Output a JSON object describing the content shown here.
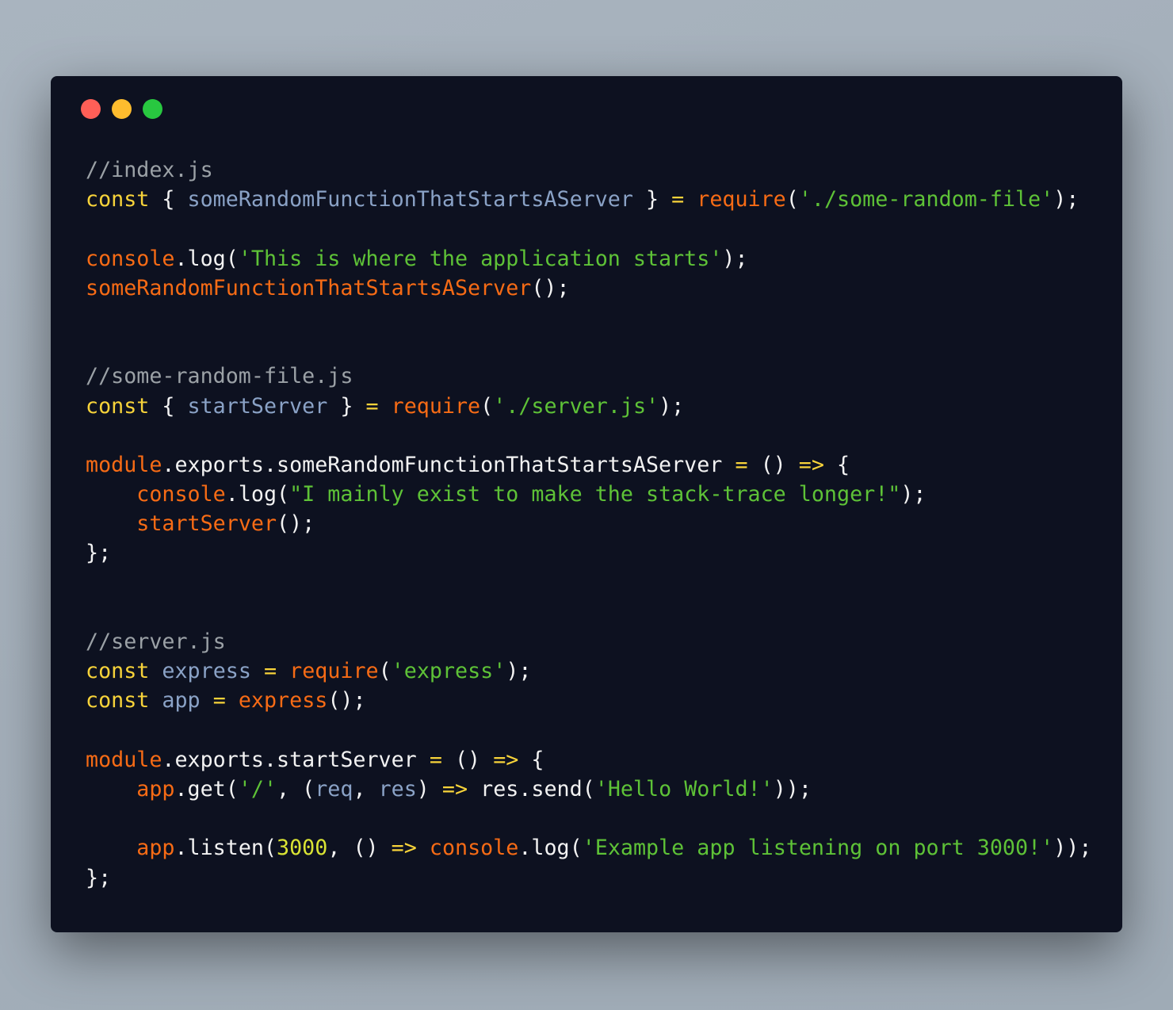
{
  "window": {
    "controls": [
      "close",
      "minimize",
      "maximize"
    ]
  },
  "code": {
    "language": "javascript",
    "lines": [
      [
        {
          "t": "comment",
          "v": "//index.js"
        }
      ],
      [
        {
          "t": "keyword",
          "v": "const"
        },
        {
          "t": "plain",
          "v": " { "
        },
        {
          "t": "var",
          "v": "someRandomFunctionThatStartsAServer"
        },
        {
          "t": "plain",
          "v": " } "
        },
        {
          "t": "op",
          "v": "="
        },
        {
          "t": "plain",
          "v": " "
        },
        {
          "t": "fn",
          "v": "require"
        },
        {
          "t": "plain",
          "v": "("
        },
        {
          "t": "str",
          "v": "'./some-random-file'"
        },
        {
          "t": "plain",
          "v": ");"
        }
      ],
      [],
      [
        {
          "t": "fn",
          "v": "console"
        },
        {
          "t": "plain",
          "v": ".log("
        },
        {
          "t": "str",
          "v": "'This is where the application starts'"
        },
        {
          "t": "plain",
          "v": ");"
        }
      ],
      [
        {
          "t": "fn",
          "v": "someRandomFunctionThatStartsAServer"
        },
        {
          "t": "plain",
          "v": "();"
        }
      ],
      [],
      [],
      [
        {
          "t": "comment",
          "v": "//some-random-file.js"
        }
      ],
      [
        {
          "t": "keyword",
          "v": "const"
        },
        {
          "t": "plain",
          "v": " { "
        },
        {
          "t": "var",
          "v": "startServer"
        },
        {
          "t": "plain",
          "v": " } "
        },
        {
          "t": "op",
          "v": "="
        },
        {
          "t": "plain",
          "v": " "
        },
        {
          "t": "fn",
          "v": "require"
        },
        {
          "t": "plain",
          "v": "("
        },
        {
          "t": "str",
          "v": "'./server.js'"
        },
        {
          "t": "plain",
          "v": ");"
        }
      ],
      [],
      [
        {
          "t": "fn",
          "v": "module"
        },
        {
          "t": "plain",
          "v": ".exports.someRandomFunctionThatStartsAServer "
        },
        {
          "t": "op",
          "v": "="
        },
        {
          "t": "plain",
          "v": " () "
        },
        {
          "t": "op",
          "v": "=>"
        },
        {
          "t": "plain",
          "v": " {"
        }
      ],
      [
        {
          "t": "plain",
          "v": "    "
        },
        {
          "t": "fn",
          "v": "console"
        },
        {
          "t": "plain",
          "v": ".log("
        },
        {
          "t": "str",
          "v": "\"I mainly exist to make the stack-trace longer!\""
        },
        {
          "t": "plain",
          "v": ");"
        }
      ],
      [
        {
          "t": "plain",
          "v": "    "
        },
        {
          "t": "fn",
          "v": "startServer"
        },
        {
          "t": "plain",
          "v": "();"
        }
      ],
      [
        {
          "t": "plain",
          "v": "};"
        }
      ],
      [],
      [],
      [
        {
          "t": "comment",
          "v": "//server.js"
        }
      ],
      [
        {
          "t": "keyword",
          "v": "const"
        },
        {
          "t": "plain",
          "v": " "
        },
        {
          "t": "var",
          "v": "express"
        },
        {
          "t": "plain",
          "v": " "
        },
        {
          "t": "op",
          "v": "="
        },
        {
          "t": "plain",
          "v": " "
        },
        {
          "t": "fn",
          "v": "require"
        },
        {
          "t": "plain",
          "v": "("
        },
        {
          "t": "str",
          "v": "'express'"
        },
        {
          "t": "plain",
          "v": ");"
        }
      ],
      [
        {
          "t": "keyword",
          "v": "const"
        },
        {
          "t": "plain",
          "v": " "
        },
        {
          "t": "var",
          "v": "app"
        },
        {
          "t": "plain",
          "v": " "
        },
        {
          "t": "op",
          "v": "="
        },
        {
          "t": "plain",
          "v": " "
        },
        {
          "t": "fn",
          "v": "express"
        },
        {
          "t": "plain",
          "v": "();"
        }
      ],
      [],
      [
        {
          "t": "fn",
          "v": "module"
        },
        {
          "t": "plain",
          "v": ".exports.startServer "
        },
        {
          "t": "op",
          "v": "="
        },
        {
          "t": "plain",
          "v": " () "
        },
        {
          "t": "op",
          "v": "=>"
        },
        {
          "t": "plain",
          "v": " {"
        }
      ],
      [
        {
          "t": "plain",
          "v": "    "
        },
        {
          "t": "fn",
          "v": "app"
        },
        {
          "t": "plain",
          "v": ".get("
        },
        {
          "t": "str",
          "v": "'/'"
        },
        {
          "t": "plain",
          "v": ", ("
        },
        {
          "t": "var",
          "v": "req"
        },
        {
          "t": "plain",
          "v": ", "
        },
        {
          "t": "var",
          "v": "res"
        },
        {
          "t": "plain",
          "v": ") "
        },
        {
          "t": "op",
          "v": "=>"
        },
        {
          "t": "plain",
          "v": " res.send("
        },
        {
          "t": "str",
          "v": "'Hello World!'"
        },
        {
          "t": "plain",
          "v": "));"
        }
      ],
      [],
      [
        {
          "t": "plain",
          "v": "    "
        },
        {
          "t": "fn",
          "v": "app"
        },
        {
          "t": "plain",
          "v": ".listen("
        },
        {
          "t": "num",
          "v": "3000"
        },
        {
          "t": "plain",
          "v": ", () "
        },
        {
          "t": "op",
          "v": "=>"
        },
        {
          "t": "plain",
          "v": " "
        },
        {
          "t": "fn",
          "v": "console"
        },
        {
          "t": "plain",
          "v": ".log("
        },
        {
          "t": "str",
          "v": "'Example app listening on port 3000!'"
        },
        {
          "t": "plain",
          "v": "));"
        }
      ],
      [
        {
          "t": "plain",
          "v": "};"
        }
      ]
    ]
  },
  "theme": {
    "background": "#0d1120",
    "comment": "#9ba1a6",
    "keyword": "#f7d33a",
    "variable": "#8aa2c6",
    "function": "#f76b15",
    "string": "#5ec237",
    "number": "#d9e334",
    "plain": "#f2f2f2",
    "close": "#ff5f57",
    "minimize": "#febc2e",
    "maximize": "#28c840"
  }
}
